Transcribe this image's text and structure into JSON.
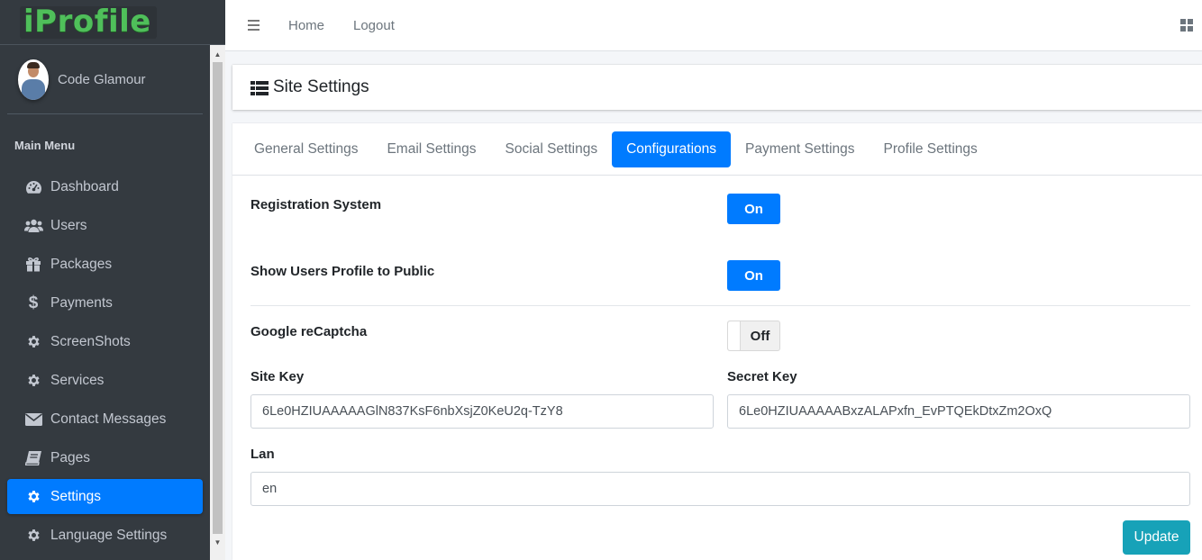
{
  "brand": {
    "logo": "iProfile"
  },
  "user": {
    "name": "Code Glamour"
  },
  "sidebar": {
    "header": "Main Menu",
    "items": [
      {
        "label": "Dashboard",
        "icon": "tachometer-icon"
      },
      {
        "label": "Users",
        "icon": "users-icon"
      },
      {
        "label": "Packages",
        "icon": "gift-icon"
      },
      {
        "label": "Payments",
        "icon": "dollar-icon"
      },
      {
        "label": "ScreenShots",
        "icon": "gear-icon"
      },
      {
        "label": "Services",
        "icon": "gear-icon"
      },
      {
        "label": "Contact Messages",
        "icon": "envelope-icon"
      },
      {
        "label": "Pages",
        "icon": "book-icon"
      },
      {
        "label": "Settings",
        "icon": "gear-icon",
        "active": true
      },
      {
        "label": "Language Settings",
        "icon": "gear-icon"
      }
    ]
  },
  "navbar": {
    "home": "Home",
    "logout": "Logout"
  },
  "page": {
    "title": "Site Settings"
  },
  "tabs": [
    "General Settings",
    "Email Settings",
    "Social Settings",
    "Configurations",
    "Payment Settings",
    "Profile Settings"
  ],
  "active_tab": "Configurations",
  "form": {
    "registration_label": "Registration System",
    "registration_state": "On",
    "public_profile_label": "Show Users Profile to Public",
    "public_profile_state": "On",
    "recaptcha_label": "Google reCaptcha",
    "recaptcha_state": "Off",
    "site_key_label": "Site Key",
    "site_key_value": "6Le0HZIUAAAAAGlN837KsF6nbXsjZ0KeU2q-TzY8",
    "secret_key_label": "Secret Key",
    "secret_key_value": "6Le0HZIUAAAAABxzALAPxfn_EvPTQEkDtxZm2OxQ",
    "lan_label": "Lan",
    "lan_value": "en",
    "update_label": "Update"
  },
  "colors": {
    "primary": "#007bff",
    "sidebar": "#343a40",
    "update_button": "#17a2b8",
    "logo_green": "#4fbf5a"
  }
}
